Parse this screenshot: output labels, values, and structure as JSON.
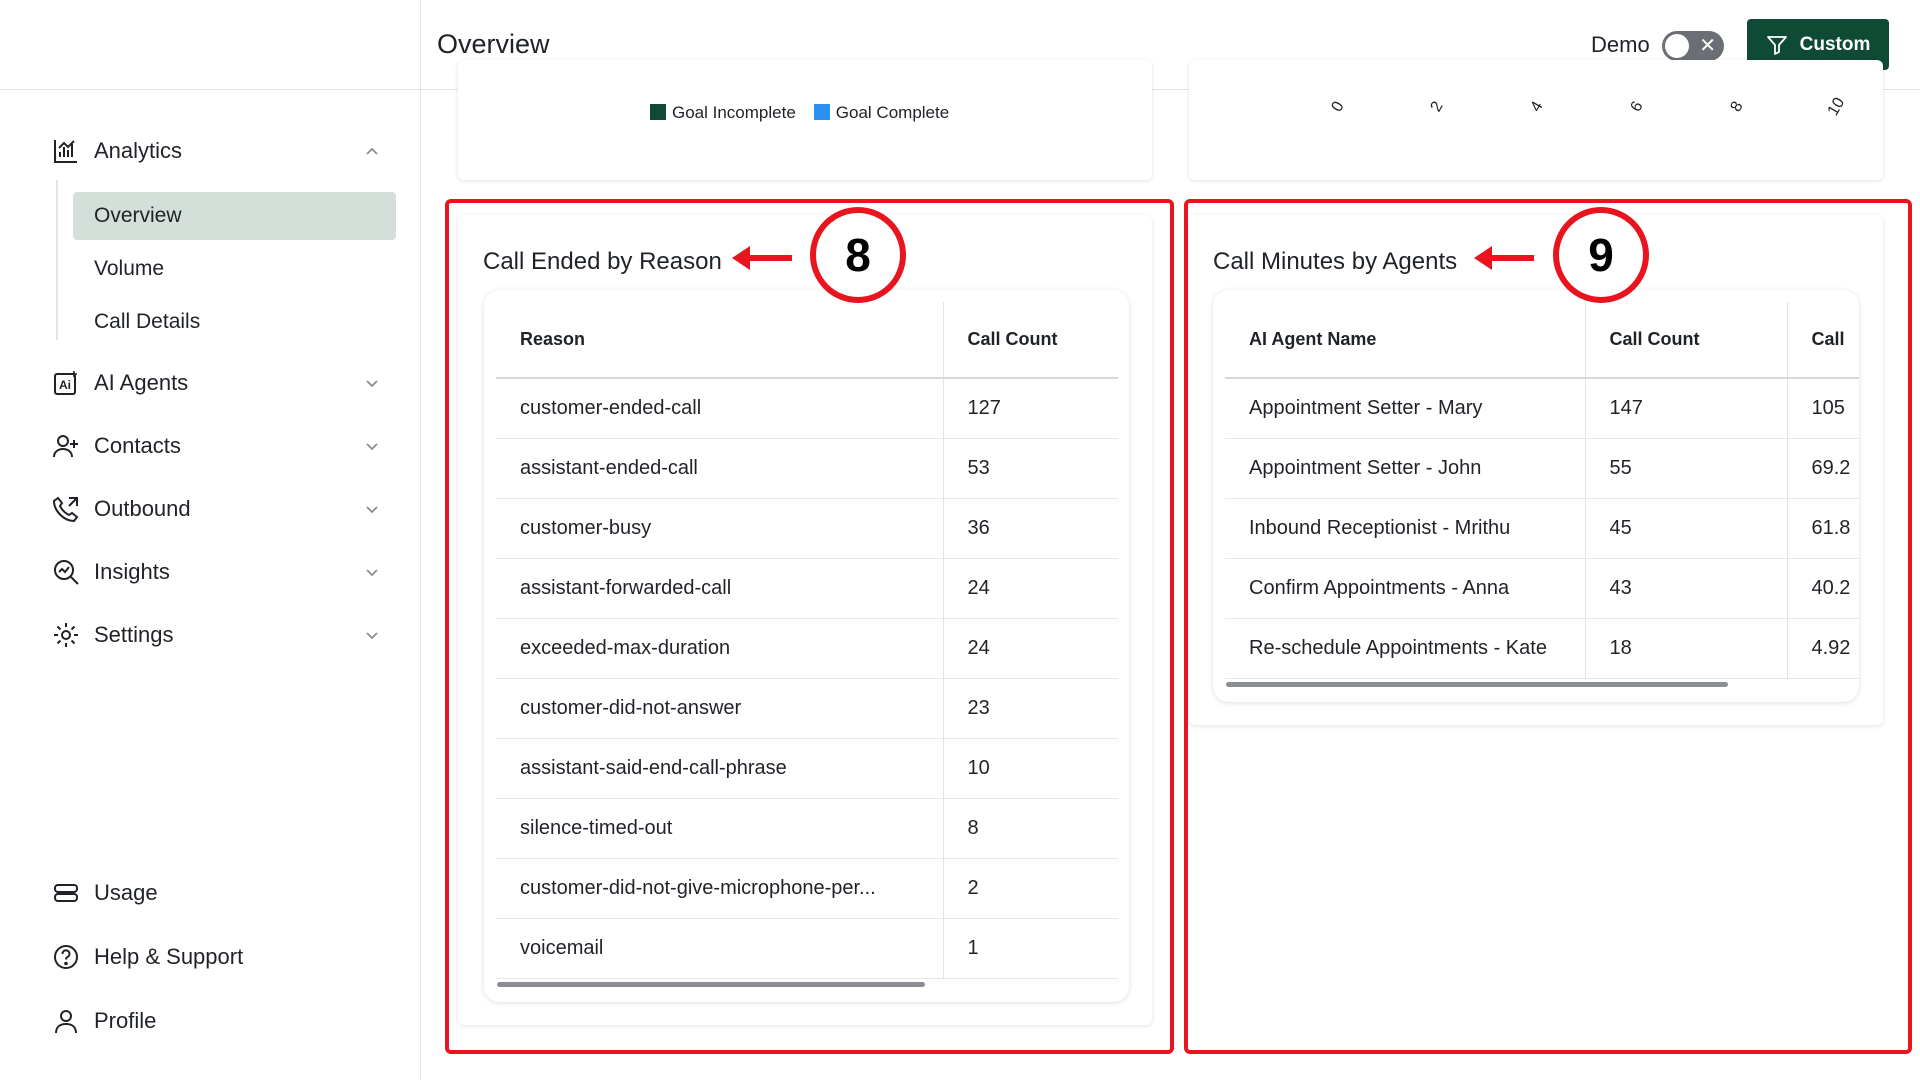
{
  "header": {
    "title": "Overview",
    "demo_label": "Demo",
    "demo_toggle_state": "off",
    "custom_button_label": "Custom"
  },
  "sidebar": {
    "analytics_label": "Analytics",
    "sub_items": [
      {
        "label": "Overview",
        "active": true
      },
      {
        "label": "Volume",
        "active": false
      },
      {
        "label": "Call Details",
        "active": false
      }
    ],
    "items": [
      {
        "label": "AI Agents",
        "icon": "ai-icon"
      },
      {
        "label": "Contacts",
        "icon": "user-plus-icon"
      },
      {
        "label": "Outbound",
        "icon": "phone-outgoing-icon"
      },
      {
        "label": "Insights",
        "icon": "insights-icon"
      },
      {
        "label": "Settings",
        "icon": "gear-icon"
      }
    ],
    "bottom_items": [
      {
        "label": "Usage",
        "icon": "usage-icon"
      },
      {
        "label": "Help & Support",
        "icon": "help-icon"
      },
      {
        "label": "Profile",
        "icon": "profile-icon"
      }
    ]
  },
  "top_left_card": {
    "legend": [
      {
        "label": "Goal Incomplete",
        "color": "#0e4a34"
      },
      {
        "label": "Goal Complete",
        "color": "#2d8ff0"
      }
    ]
  },
  "top_right_card": {
    "x_ticks": [
      "0",
      "2",
      "4",
      "6",
      "8",
      "10"
    ]
  },
  "call_ended_card": {
    "title": "Call Ended by Reason",
    "annotation_number": "8",
    "columns": [
      "Reason",
      "Call Count"
    ],
    "rows": [
      [
        "customer-ended-call",
        "127"
      ],
      [
        "assistant-ended-call",
        "53"
      ],
      [
        "customer-busy",
        "36"
      ],
      [
        "assistant-forwarded-call",
        "24"
      ],
      [
        "exceeded-max-duration",
        "24"
      ],
      [
        "customer-did-not-answer",
        "23"
      ],
      [
        "assistant-said-end-call-phrase",
        "10"
      ],
      [
        "silence-timed-out",
        "8"
      ],
      [
        "customer-did-not-give-microphone-per...",
        "2"
      ],
      [
        "voicemail",
        "1"
      ]
    ]
  },
  "call_minutes_card": {
    "title": "Call Minutes by Agents",
    "annotation_number": "9",
    "columns": [
      "AI Agent Name",
      "Call Count",
      "Call"
    ],
    "rows": [
      [
        "Appointment Setter - Mary",
        "147",
        "105"
      ],
      [
        "Appointment Setter - John",
        "55",
        "69.2"
      ],
      [
        "Inbound Receptionist - Mrithu",
        "45",
        "61.8"
      ],
      [
        "Confirm Appointments - Anna",
        "43",
        "40.2"
      ],
      [
        "Re-schedule Appointments - Kate",
        "18",
        "4.92"
      ]
    ]
  },
  "colors": {
    "brand_green": "#0e4a34",
    "annotation_red": "#e8141e",
    "active_nav_bg": "#d5dfd9"
  }
}
